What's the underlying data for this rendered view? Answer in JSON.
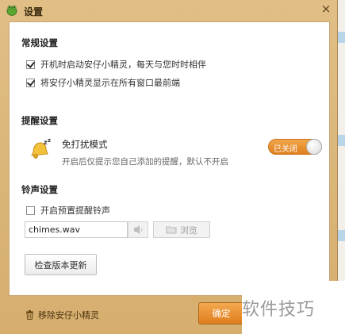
{
  "window": {
    "title": "设置",
    "close_glyph": "×"
  },
  "general": {
    "title": "常规设置",
    "options": [
      {
        "label": "开机时启动安仔小精灵，每天与您时时相伴",
        "checked": true
      },
      {
        "label": "将安仔小精灵显示在所有窗口最前端",
        "checked": true
      }
    ]
  },
  "reminder": {
    "title": "提醒设置",
    "icon": "bell-zz-icon",
    "mode_title": "免打扰模式",
    "mode_desc": "开启后仅提示您自己添加的提醒，默认不开启",
    "toggle_label": "已关闭",
    "toggle_on": false
  },
  "ringtone": {
    "title": "铃声设置",
    "preset_label": "开启预置提醒铃声",
    "preset_checked": false,
    "sound_file": "chimes.wav",
    "browse_label": "浏览"
  },
  "update_button": "检查版本更新",
  "footer": {
    "remove_label": "移除安仔小精灵",
    "ok_label": "确定"
  },
  "watermark": "软件技巧",
  "colors": {
    "accent": "#e88a2a",
    "frame": "#d9b478"
  }
}
